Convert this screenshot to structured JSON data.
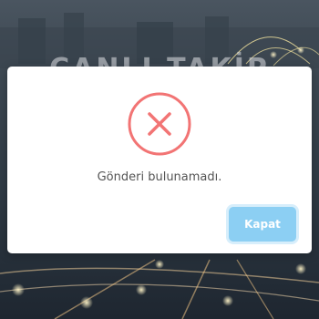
{
  "background": {
    "title": "CANLI TAKİP"
  },
  "dialog": {
    "icon": "error-x-icon",
    "message": "Gönderi bulunamadı.",
    "close_label": "Kapat",
    "colors": {
      "icon": "#f27474",
      "button": "#8ccff3",
      "message": "#545454"
    }
  }
}
